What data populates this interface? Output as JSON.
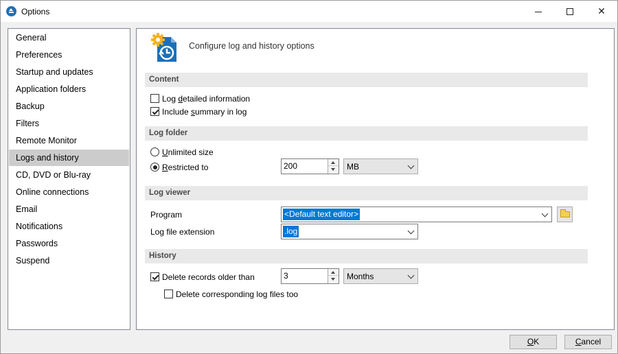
{
  "window": {
    "title": "Options"
  },
  "sidebar": {
    "items": [
      {
        "label": "General"
      },
      {
        "label": "Preferences"
      },
      {
        "label": "Startup and updates"
      },
      {
        "label": "Application folders"
      },
      {
        "label": "Backup"
      },
      {
        "label": "Filters"
      },
      {
        "label": "Remote Monitor"
      },
      {
        "label": "Logs and history",
        "selected": true
      },
      {
        "label": "CD, DVD or Blu-ray"
      },
      {
        "label": "Online connections"
      },
      {
        "label": "Email"
      },
      {
        "label": "Notifications"
      },
      {
        "label": "Passwords"
      },
      {
        "label": "Suspend"
      }
    ]
  },
  "main": {
    "header": {
      "icon": "log-history-gear-icon",
      "text": "Configure log and history options"
    },
    "content": {
      "title": "Content",
      "log_detailed": {
        "pre": "Log ",
        "accel": "d",
        "post": "etailed information",
        "checked": false
      },
      "include_summary": {
        "pre": "Include ",
        "accel": "s",
        "post": "ummary in log",
        "checked": true
      }
    },
    "log_folder": {
      "title": "Log folder",
      "unlimited": {
        "accel": "U",
        "post": "nlimited size",
        "selected": false
      },
      "restricted": {
        "accel": "R",
        "post": "estricted to",
        "selected": true
      },
      "size_value": "200",
      "unit": "MB"
    },
    "log_viewer": {
      "title": "Log viewer",
      "program_label": "Program",
      "program_value": "<Default text editor>",
      "extension_label": "Log file extension",
      "extension_value": ".log"
    },
    "history": {
      "title": "History",
      "delete_older": {
        "label": "Delete records older than",
        "checked": true
      },
      "age_value": "3",
      "age_unit": "Months",
      "delete_logs": {
        "label": "Delete corresponding log files too",
        "checked": false
      }
    }
  },
  "buttons": {
    "ok": {
      "accel": "O",
      "post": "K"
    },
    "cancel": {
      "accel": "C",
      "post": "ancel"
    }
  },
  "colors": {
    "accent": "#0078d7",
    "selected_item": "#cccccc",
    "section_bg": "#e9e9e9",
    "icon_blue": "#1d6fb8",
    "gear": "#f0b323"
  }
}
